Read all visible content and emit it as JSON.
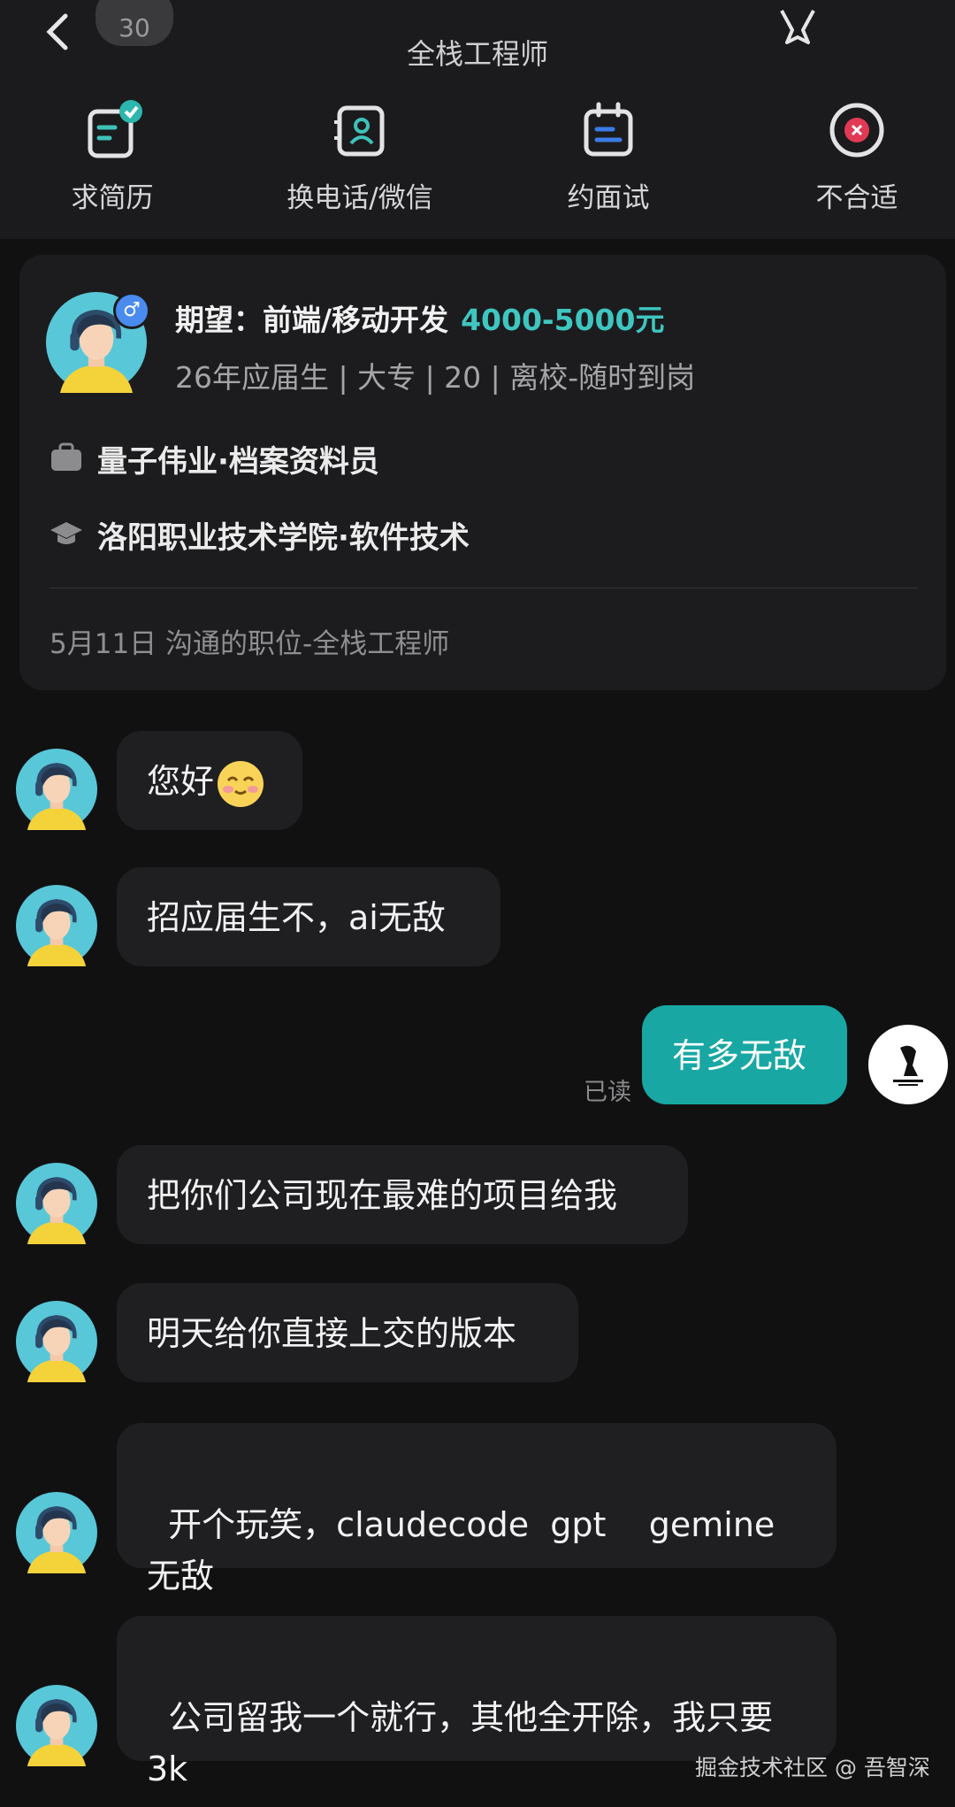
{
  "header": {
    "title": "全栈工程师",
    "badge": "30",
    "actions": [
      {
        "label": "求简历",
        "icon": "resume-check-icon"
      },
      {
        "label": "换电话/微信",
        "icon": "contact-swap-icon"
      },
      {
        "label": "约面试",
        "icon": "calendar-icon"
      },
      {
        "label": "不合适",
        "icon": "reject-icon"
      }
    ]
  },
  "profile": {
    "expect_label": "期望：前端/移动开发",
    "salary": "4000-5000元",
    "meta": "26年应届生 | 大专 | 20 | 离校-随时到岗",
    "experience": "量子伟业·档案资料员",
    "education": "洛阳职业技术学院·软件技术",
    "footer": "5月11日 沟通的职位-全栈工程师",
    "gender_symbol": "♂"
  },
  "messages": [
    {
      "text": "您好",
      "from": "other"
    },
    {
      "text": "招应届生不，ai无敌",
      "from": "other"
    },
    {
      "text": "有多无敌",
      "from": "me"
    },
    {
      "text": "把你们公司现在最难的项目给我",
      "from": "other"
    },
    {
      "text": "明天给你直接上交的版本",
      "from": "other"
    },
    {
      "text": "开个玩笑，claudecode  gpt    gemine\n无敌",
      "from": "other"
    },
    {
      "text": "公司留我一个就行，其他全开除，我只要\n3k",
      "from": "other"
    }
  ],
  "read_status": "已读",
  "watermark": "掘金技术社区 @ 吾智深",
  "colors": {
    "accent": "#18a7a3",
    "salary": "#3fc6c0",
    "background": "#111112"
  }
}
